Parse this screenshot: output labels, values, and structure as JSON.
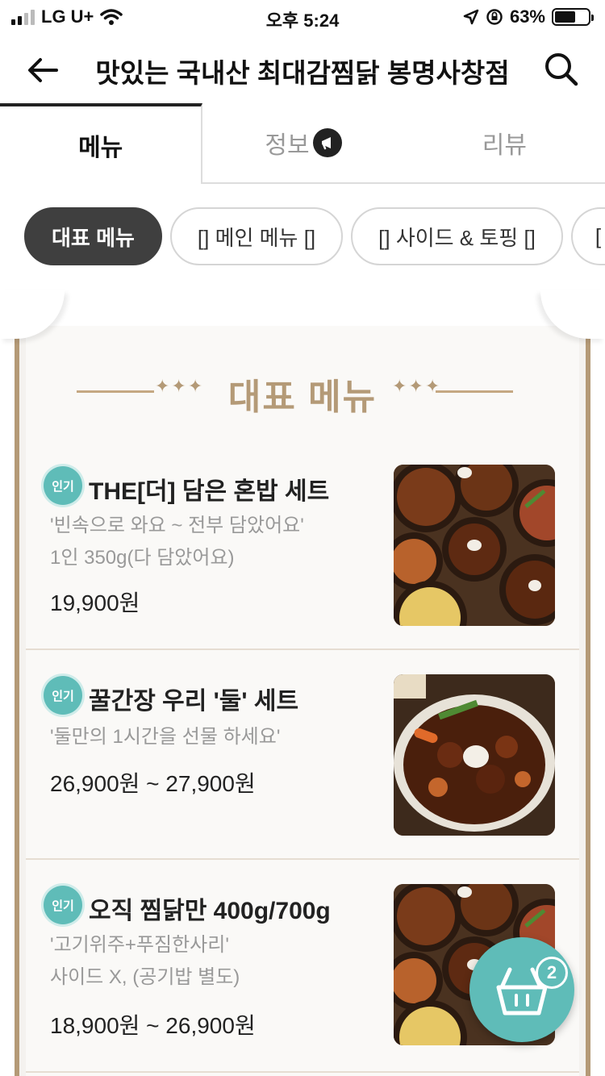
{
  "status": {
    "carrier": "LG U+",
    "time": "오후 5:24",
    "battery": "63%",
    "battery_level": 0.63
  },
  "header": {
    "title": "맛있는 국내산 최대감찜닭 봉명사창점"
  },
  "tabs": [
    {
      "label": "메뉴"
    },
    {
      "label": "정보"
    },
    {
      "label": "리뷰"
    }
  ],
  "categories": [
    {
      "label": "대표 메뉴"
    },
    {
      "label": "[] 메인 메뉴 []"
    },
    {
      "label": "[] 사이드 & 토핑 []"
    },
    {
      "label": "["
    }
  ],
  "section": {
    "title": "대표 메뉴",
    "ornament": "✦✦✦"
  },
  "menu_items": [
    {
      "badge": "인기",
      "name": "THE[더] 담은 혼밥 세트",
      "desc1": "'빈속으로 와요 ~ 전부 담았어요'",
      "desc2": "1인 350g(다 담았어요)",
      "price": "19,900원"
    },
    {
      "badge": "인기",
      "name": "꿀간장 우리 '둘' 세트",
      "desc1": "'둘만의 1시간을 선물 하세요'",
      "desc2": "",
      "price": "26,900원 ~ 27,900원"
    },
    {
      "badge": "인기",
      "name": "오직 찜닭만 400g/700g",
      "desc1": "'고기위주+푸짐한사리'",
      "desc2": "사이드 X, (공기밥 별도)",
      "price": "18,900원 ~ 26,900원"
    }
  ],
  "cart": {
    "count": "2"
  },
  "colors": {
    "accent_gold": "#b49a77",
    "badge_teal": "#5fbcb8",
    "chip_active": "#3f3f3f"
  }
}
